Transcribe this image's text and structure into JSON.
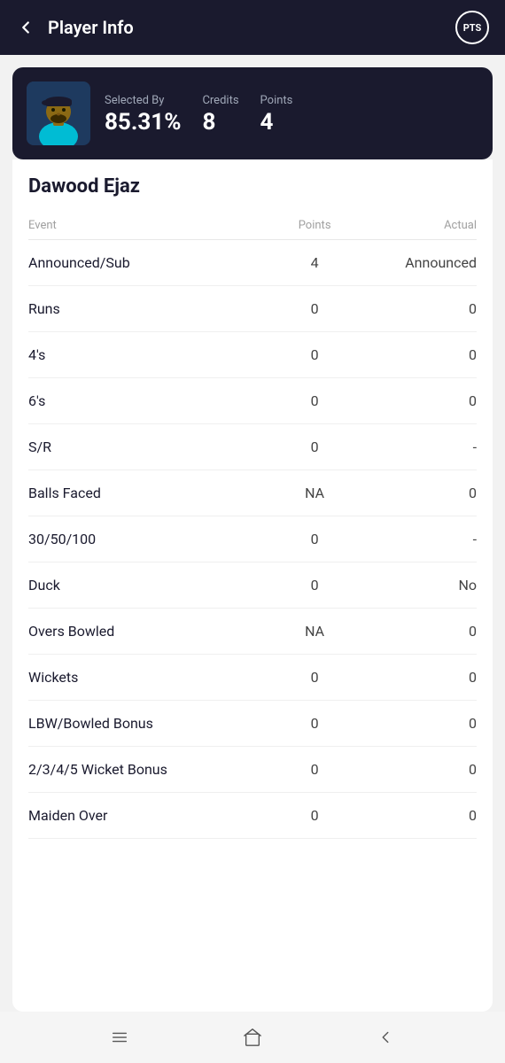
{
  "header": {
    "title": "Player Info",
    "back_icon": "←",
    "pts_label": "PTS"
  },
  "player": {
    "name": "Dawood Ejaz",
    "selected_by_label": "Selected By",
    "selected_by_value": "85.31%",
    "credits_label": "Credits",
    "credits_value": "8",
    "points_label": "Points",
    "points_value": "4"
  },
  "table": {
    "columns": [
      "Event",
      "Points",
      "Actual"
    ],
    "rows": [
      {
        "event": "Announced/Sub",
        "points": "4",
        "actual": "Announced"
      },
      {
        "event": "Runs",
        "points": "0",
        "actual": "0"
      },
      {
        "event": "4's",
        "points": "0",
        "actual": "0"
      },
      {
        "event": "6's",
        "points": "0",
        "actual": "0"
      },
      {
        "event": "S/R",
        "points": "0",
        "actual": "-"
      },
      {
        "event": "Balls Faced",
        "points": "NA",
        "actual": "0"
      },
      {
        "event": "30/50/100",
        "points": "0",
        "actual": "-"
      },
      {
        "event": "Duck",
        "points": "0",
        "actual": "No"
      },
      {
        "event": "Overs Bowled",
        "points": "NA",
        "actual": "0"
      },
      {
        "event": "Wickets",
        "points": "0",
        "actual": "0"
      },
      {
        "event": "LBW/Bowled Bonus",
        "points": "0",
        "actual": "0"
      },
      {
        "event": "2/3/4/5 Wicket Bonus",
        "points": "0",
        "actual": "0"
      },
      {
        "event": "Maiden Over",
        "points": "0",
        "actual": "0"
      }
    ]
  },
  "nav": {
    "menu_icon": "menu",
    "home_icon": "home",
    "back_icon": "back"
  }
}
